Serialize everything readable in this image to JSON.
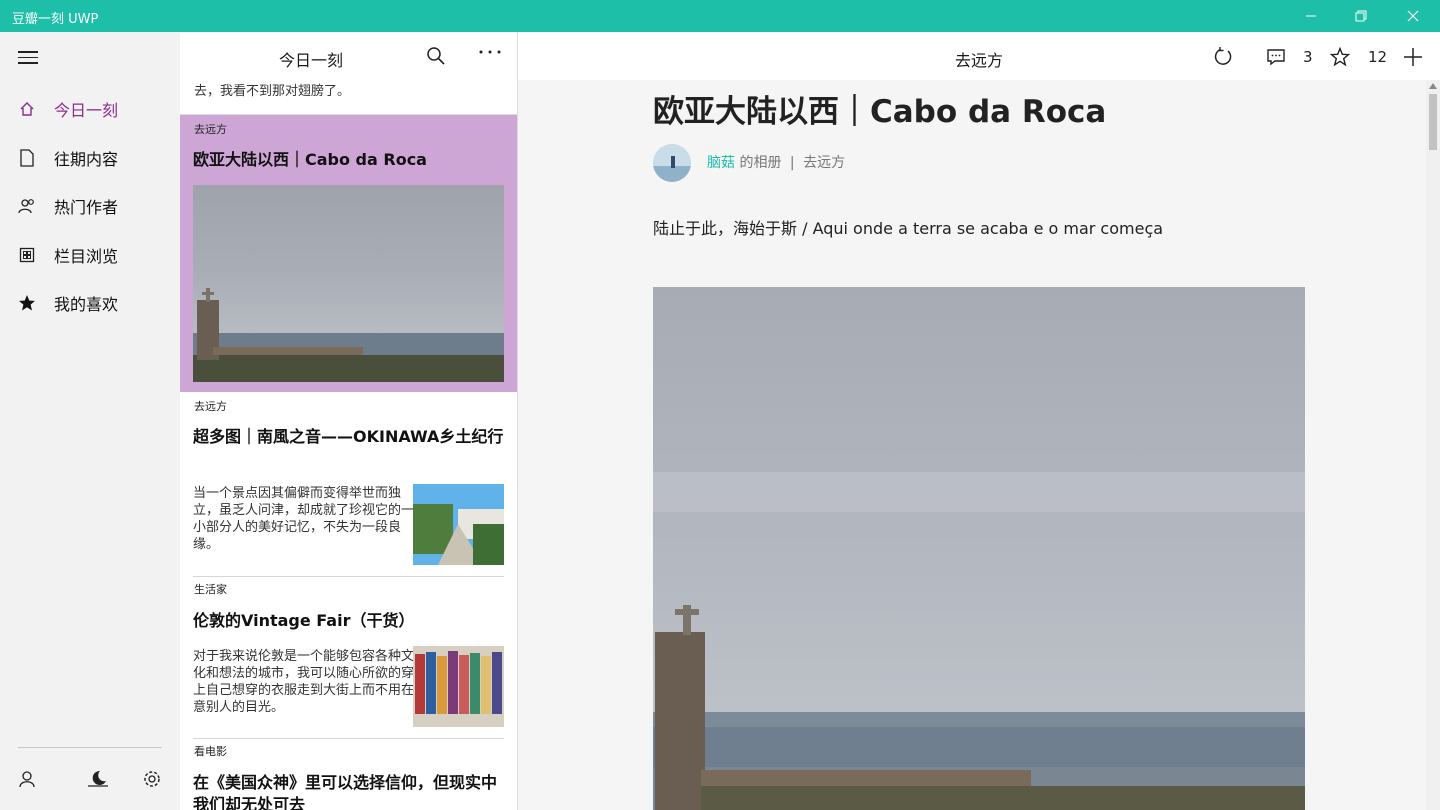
{
  "window": {
    "title": "豆瓣一刻 UWP"
  },
  "nav": {
    "items": [
      {
        "label": "今日一刻",
        "icon": "home-icon",
        "active": true
      },
      {
        "label": "往期内容",
        "icon": "document-icon"
      },
      {
        "label": "热门作者",
        "icon": "people-icon"
      },
      {
        "label": "栏目浏览",
        "icon": "grid-icon"
      },
      {
        "label": "我的喜欢",
        "icon": "star-icon"
      }
    ],
    "bottom": [
      "user-icon",
      "night-mode-icon",
      "settings-icon"
    ]
  },
  "list": {
    "title": "今日一刻",
    "partial_excerpt": "去，我看不到那对翅膀了。",
    "selected": {
      "category": "去远方",
      "title": "欧亚大陆以西｜Cabo da Roca"
    },
    "items": [
      {
        "category": "去远方",
        "title": "超多图｜南風之音——OKINAWA乡土纪行",
        "excerpt": "当一个景点因其偏僻而变得举世而独立，虽乏人问津，却成就了珍视它的一小部分人的美好记忆，不失为一段良缘。"
      },
      {
        "category": "生活家",
        "title": "伦敦的Vintage Fair（干货）",
        "excerpt": "对于我来说伦敦是一个能够包容各种文化和想法的城市，我可以随心所欲的穿上自己想穿的衣服走到大街上而不用在意别人的目光。"
      },
      {
        "category": "看电影",
        "title": "在《美国众神》里可以选择信仰，但现实中我们却无处可去"
      }
    ]
  },
  "detail": {
    "header_title": "去远方",
    "comment_count": "3",
    "like_count": "12",
    "title": "欧亚大陆以西｜Cabo da Roca",
    "author": "脑菇",
    "byline_mid": "的相册",
    "byline_sep": "|",
    "column": "去远方",
    "lead": "陆止于此，海始于斯 / Aqui onde a terra se acaba e o mar começa"
  },
  "colors": {
    "titlebar": "#1dbfa9",
    "accent": "#8c2b8e",
    "selected_bg": "#cda6d6"
  }
}
